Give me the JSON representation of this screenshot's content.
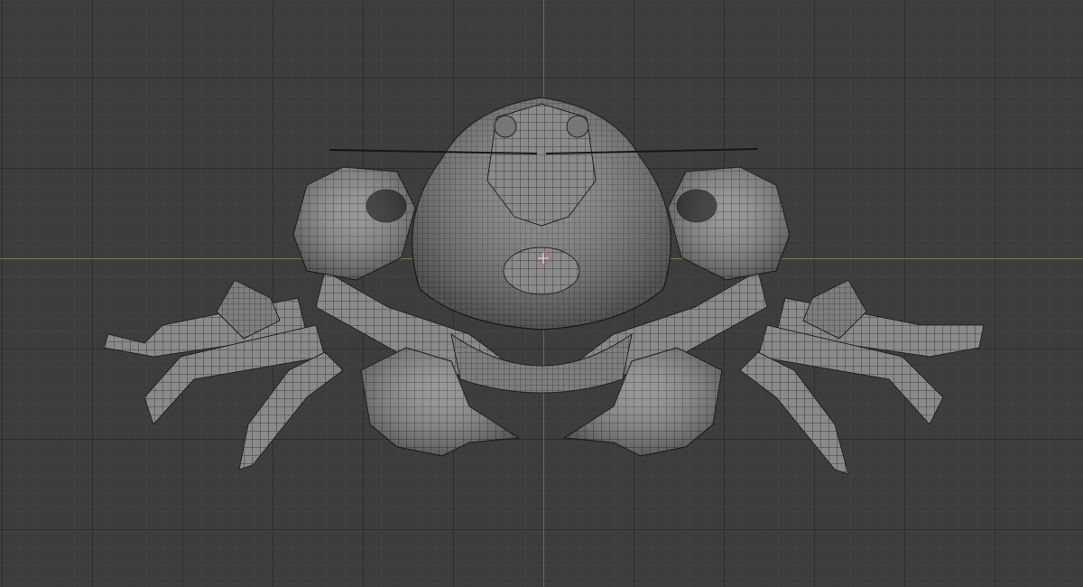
{
  "viewport": {
    "grid_background": "#3d3d3d",
    "grid_line_color": "#2f2f2f",
    "x_axis_color": "#7f7a3f",
    "z_axis_color": "#3f6bb4"
  },
  "model": {
    "kind": "crab-mesh",
    "shading": "solid-gray-with-wireframe",
    "mesh_color": "#8c8c8c",
    "wire_color": "#2a2a2a"
  },
  "cursor_3d": {
    "icon": "3d-cursor-icon",
    "color": "#e05a5a"
  }
}
